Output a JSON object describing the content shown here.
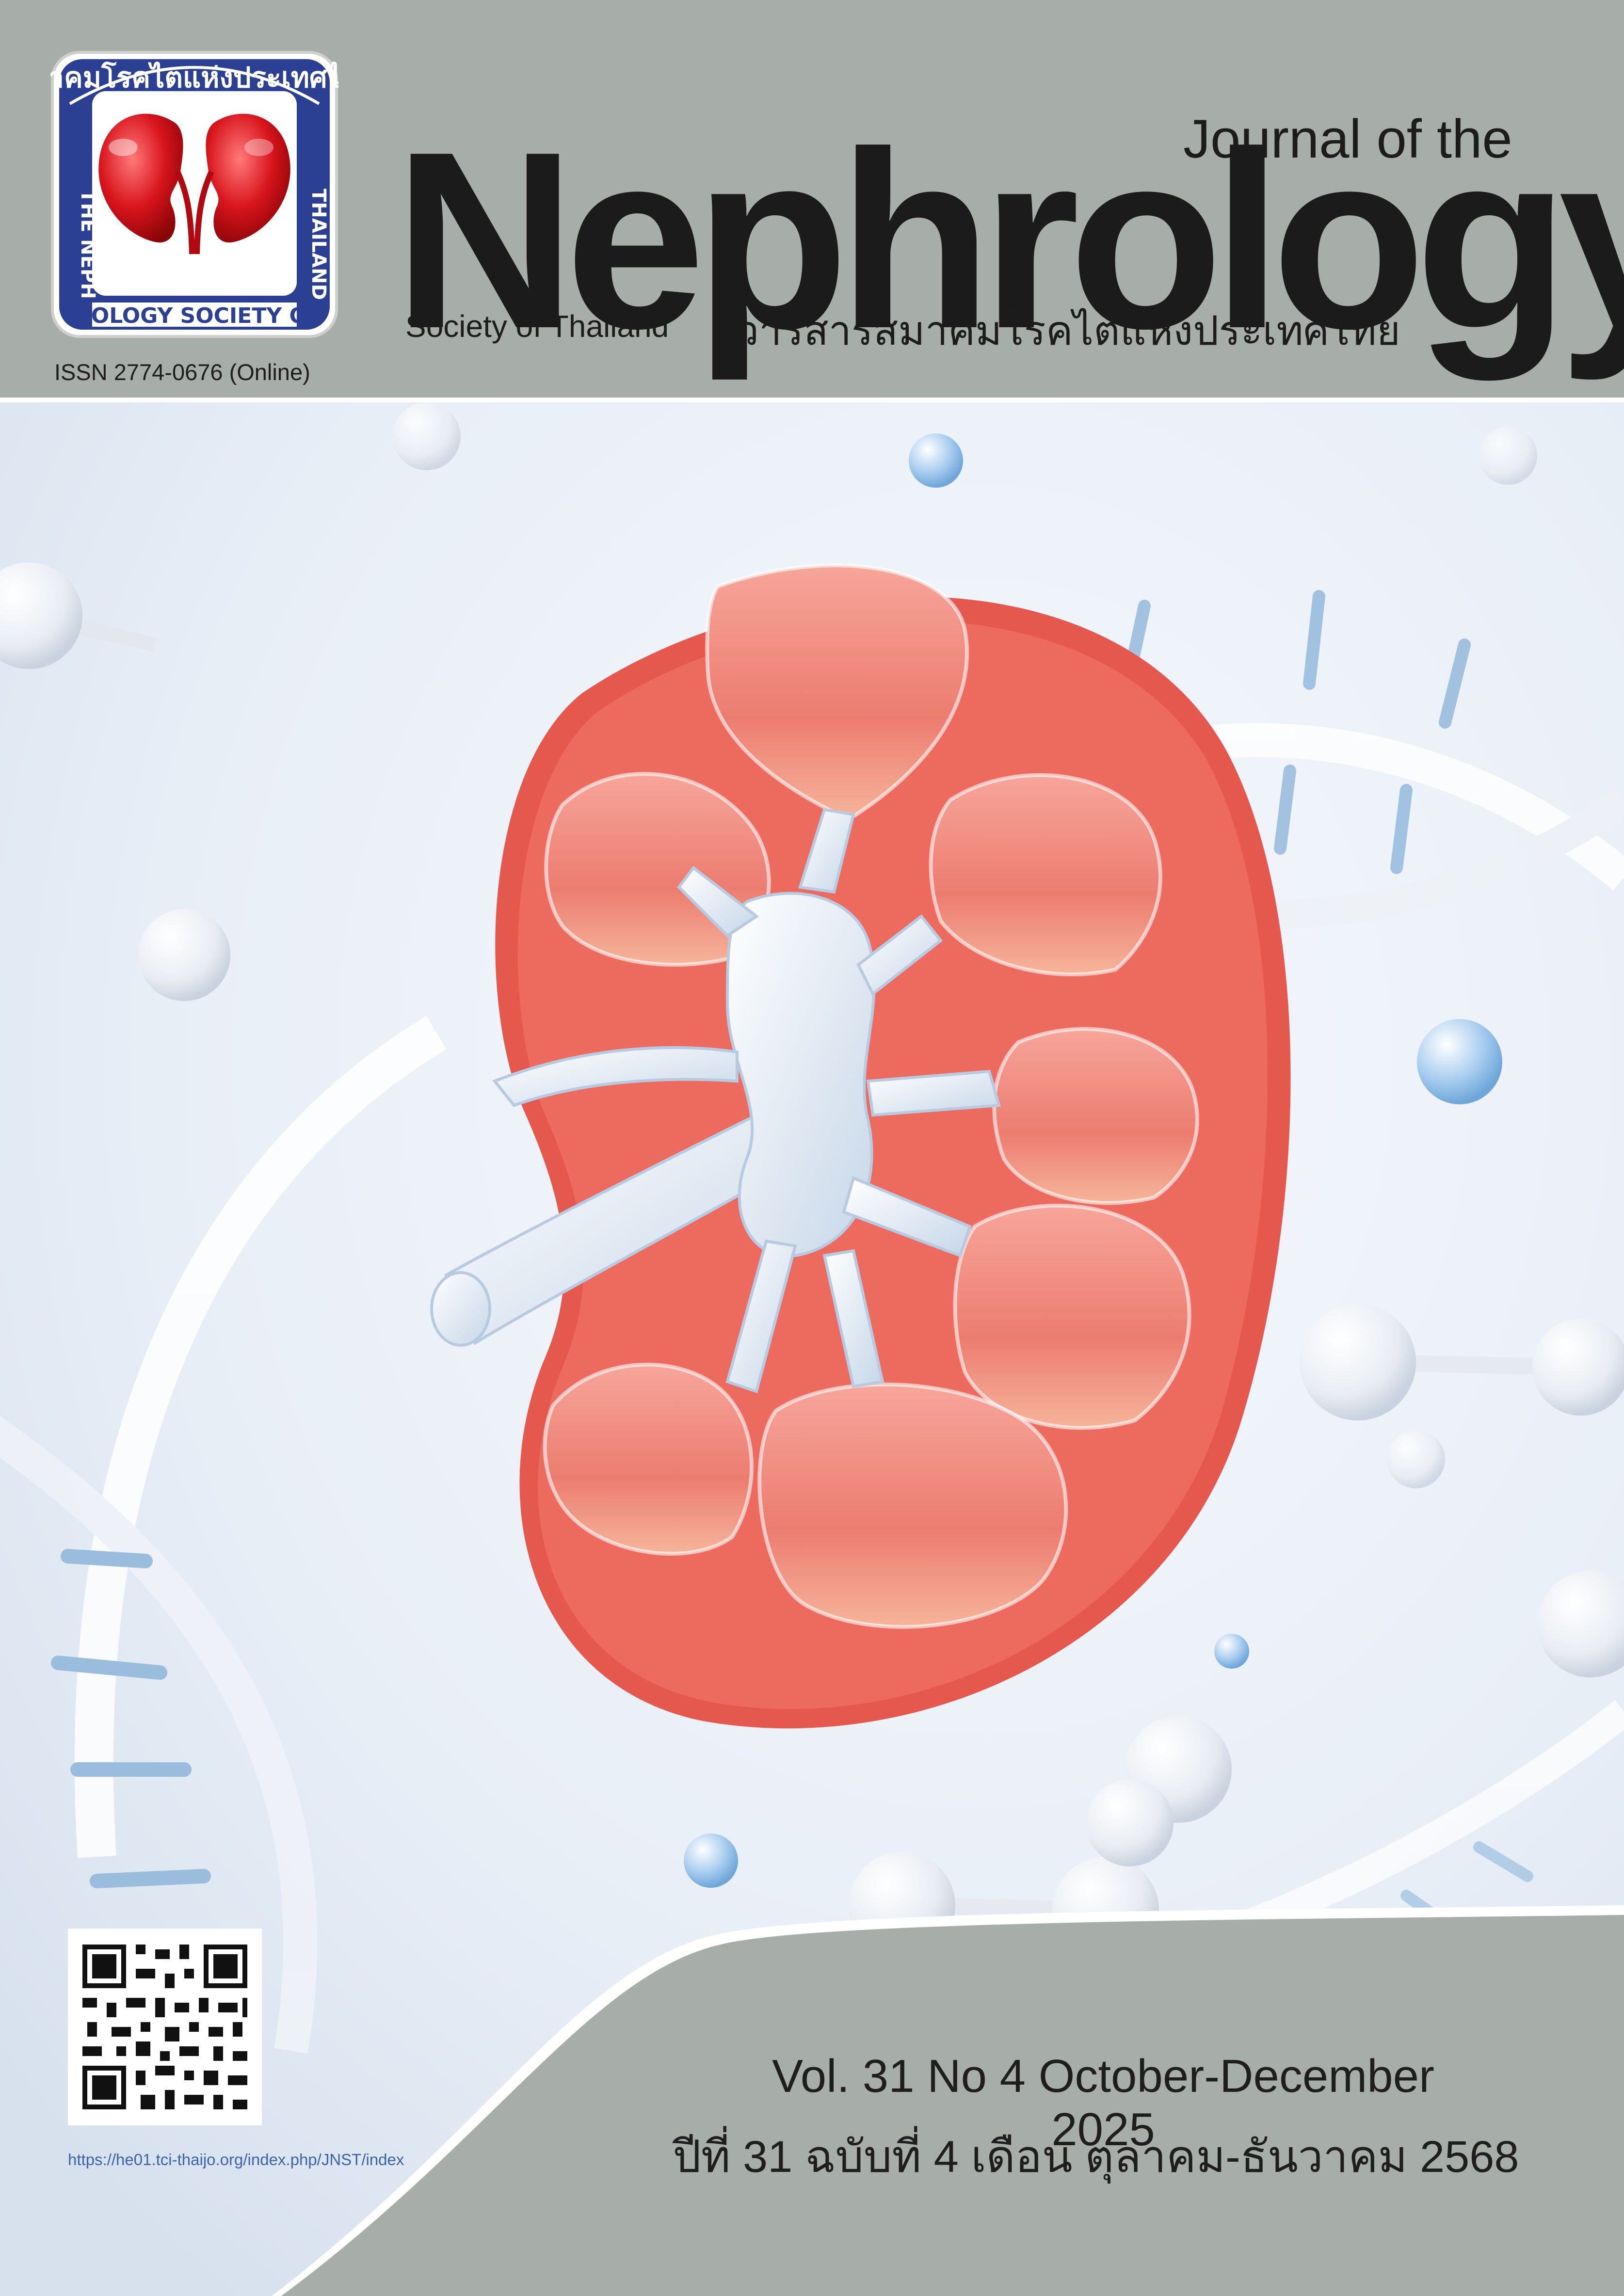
{
  "header": {
    "journal_of_the": "Journal of the",
    "nephrology": "Nephrology",
    "society_of_thailand": "Society of Thailand",
    "thai_title": "วารสารสมาคมโรคไตแห่งประเทศไทย",
    "issn": "ISSN 2774-0676 (Online)"
  },
  "logo": {
    "top_text": "สมาคมโรคไตแห่งประเทศไทย",
    "left_text": "THE NEPH",
    "bottom_text": "ROLOGY SOCIETY OF",
    "right_text": "THAILAND",
    "icon": "kidneys-icon"
  },
  "cover_art": {
    "icon": "kidney-cross-section-icon"
  },
  "footer": {
    "qr_url": "https://he01.tci-thaijo.org/index.php/JNST/index",
    "volume_en": "Vol. 31 No 4 October-December 2025",
    "volume_th": "ปีที่ 31 ฉบับที่ 4 เดือน ตุลาคม-ธันวาคม 2568"
  },
  "colors": {
    "band": "#a7aea9",
    "logo_blue": "#2b3f93",
    "kidney_red": "#e8645a",
    "vessel": "#dfe9f3"
  }
}
